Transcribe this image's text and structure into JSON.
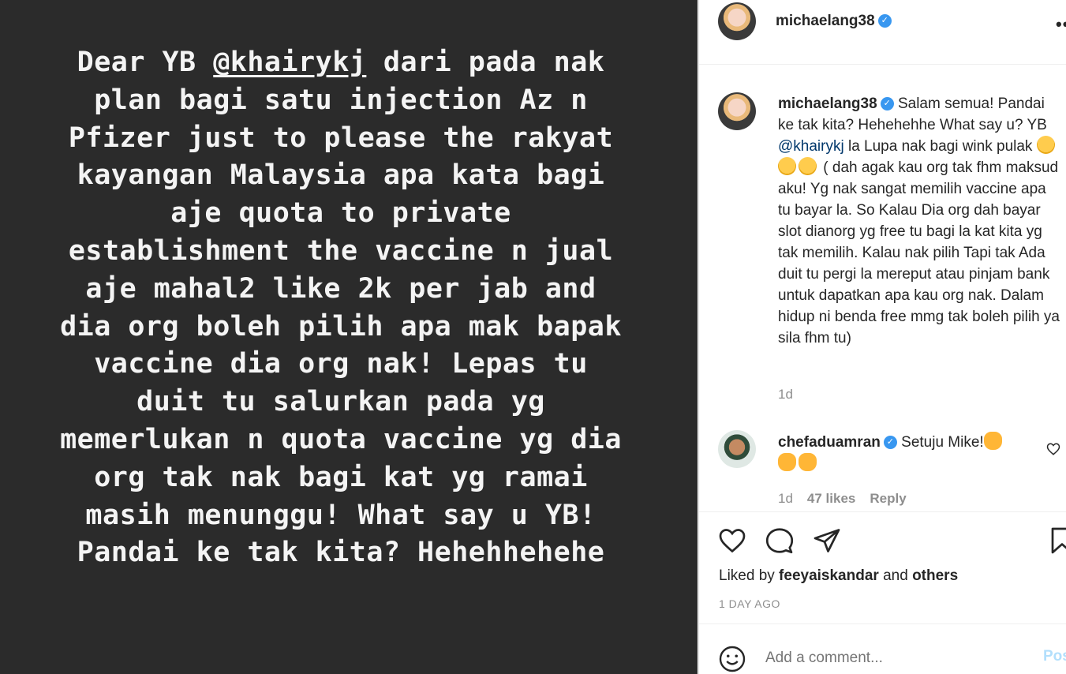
{
  "story": {
    "lines": [
      {
        "pre": "Dear YB ",
        "mention": "@khairykj",
        "post": " dari pada nak"
      },
      {
        "text": "plan bagi satu injection Az n"
      },
      {
        "text": "Pfizer just to please the rakyat"
      },
      {
        "text": "kayangan Malaysia apa kata bagi"
      },
      {
        "text": "aje quota to private"
      },
      {
        "text": "establishment the vaccine n jual"
      },
      {
        "text": "aje mahal2 like 2k per jab and"
      },
      {
        "text": "dia org boleh pilih apa mak bapak"
      },
      {
        "text": "vaccine dia org nak! Lepas tu"
      },
      {
        "text": "duit tu salurkan pada yg"
      },
      {
        "text": "memerlukan n quota vaccine yg dia"
      },
      {
        "text": "org tak nak bagi kat yg ramai"
      },
      {
        "text": "masih menunggu! What say u YB!"
      },
      {
        "text": "Pandai ke tak kita? Hehehhehehe"
      }
    ]
  },
  "header": {
    "username": "michaelang38",
    "more": "••"
  },
  "caption": {
    "username": "michaelang38",
    "part1": " Salam semua! Pandai ke tak kita? Hehehehhe What say u? YB ",
    "mention": "@khairykj",
    "part2": " la Lupa nak bagi wink pulak ",
    "part3": " ( dah agak kau org tak fhm maksud aku! Yg nak sangat memilih vaccine apa tu bayar la. So Kalau Dia org dah bayar slot dianorg yg free tu bagi la kat kita yg tak memilih. Kalau nak pilih Tapi tak Ada duit tu pergi la mereput atau pinjam bank untuk dapatkan apa kau org nak. Dalam hidup ni benda free mmg tak boleh pilih ya sila fhm tu)",
    "time": "1d"
  },
  "comment": {
    "username": "chefaduamran",
    "text": " Setuju Mike!",
    "time": "1d",
    "likes": "47 likes",
    "reply": "Reply"
  },
  "footer": {
    "liked_prefix": "Liked by ",
    "liked_user": "feeyaiskandar",
    "liked_mid": " and ",
    "liked_others": "others",
    "date": "1 DAY AGO",
    "placeholder": "Add a comment...",
    "post": "Post"
  },
  "colors": {
    "story_bg": "#2b2b2b",
    "verified": "#3897f0",
    "post_button": "#b2dffc"
  }
}
